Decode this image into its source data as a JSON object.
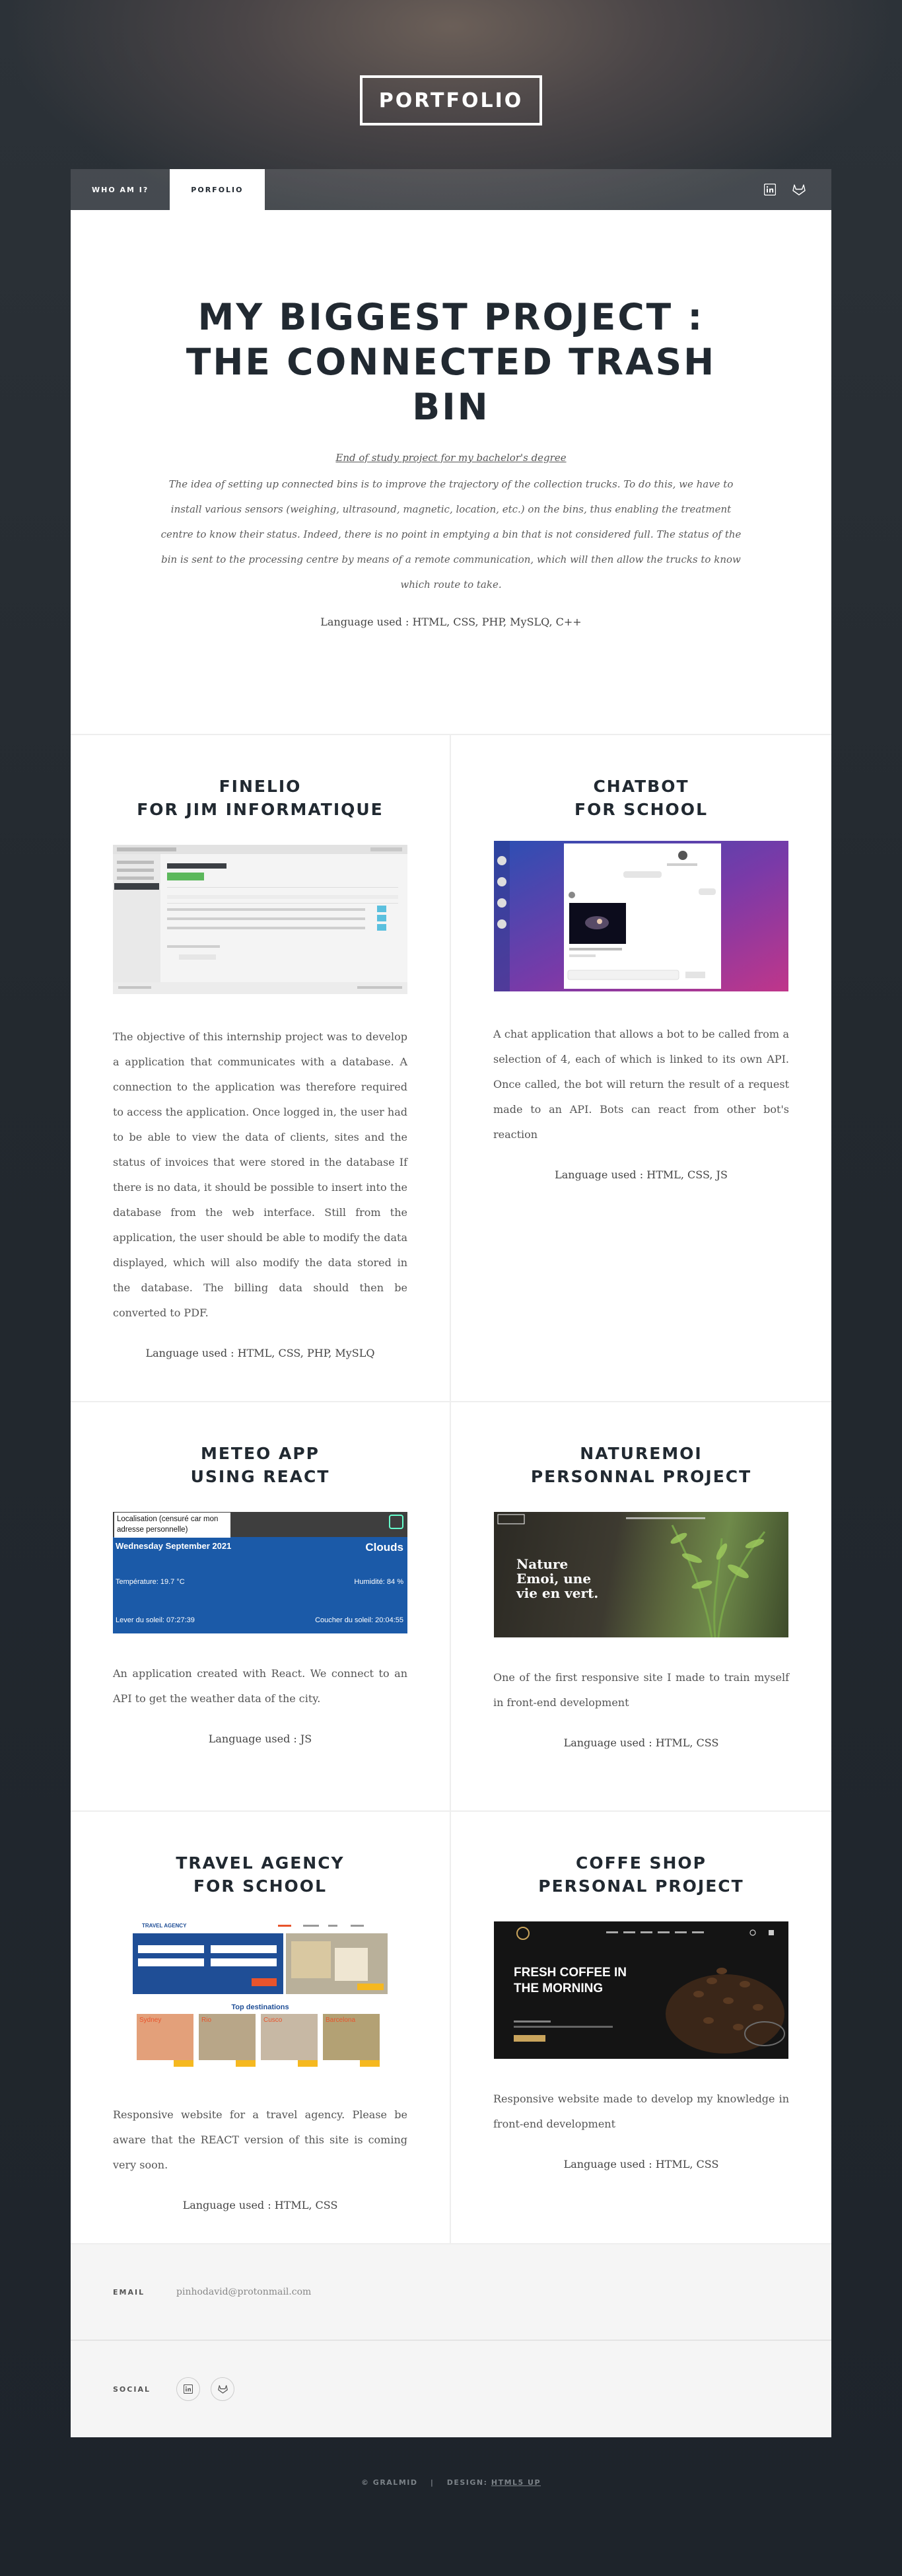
{
  "header": {
    "logo": "PORTFOLIO"
  },
  "nav": {
    "tabs": [
      {
        "label": "WHO AM I?"
      },
      {
        "label": "PORFOLIO"
      }
    ],
    "icons": [
      "linkedin-icon",
      "gitlab-icon"
    ]
  },
  "featured": {
    "title": "MY BIGGEST PROJECT : THE CONNECTED TRASH BIN",
    "subtitle": "End of study project for my bachelor's degree",
    "description": "The idea of setting up connected bins is to improve the trajectory of the collection trucks. To do this, we have to install various sensors (weighing, ultrasound, magnetic, location, etc.) on the bins, thus enabling the treatment centre to know their status. Indeed, there is no point in emptying a bin that is not considered full. The status of the bin is sent to the processing centre by means of a remote communication, which will then allow the trucks to know which route to take.",
    "language": "Language used : HTML, CSS, PHP, MySLQ, C++"
  },
  "projects": [
    {
      "title_line1": "FINELIO",
      "title_line2": "FOR JIM INFORMATIQUE",
      "description": "The objective of this internship project was to develop a application that communicates with a database. A connection to the application was therefore required to access the application. Once logged in, the user had to be able to view the data of clients, sites and the status of invoices that were stored in the database If there is no data, it should be possible to insert into the database from the web interface. Still from the application, the user should be able to modify the data displayed, which will also modify the data stored in the database. The billing data should then be converted to PDF.",
      "language": "Language used : HTML, CSS, PHP, MySLQ"
    },
    {
      "title_line1": "CHATBOT",
      "title_line2": "FOR SCHOOL",
      "description": "A chat application that allows a bot to be called from a selection of 4, each of which is linked to its own API. Once called, the bot will return the result of a request made to an API. Bots can react from other bot's reaction",
      "language": "Language used : HTML, CSS, JS"
    },
    {
      "title_line1": "METEO APP",
      "title_line2": "USING REACT",
      "description": "An application created with React. We connect to an API to get the weather data of the city.",
      "language": "Language used : JS",
      "weather": {
        "location_placeholder": "Localisation (censuré car mon adresse personnelle)",
        "date": "Wednesday September 2021",
        "condition": "Clouds",
        "temperature": "Température: 19.7 °C",
        "humidity": "Humidité: 84 %",
        "sunrise": "Lever du soleil: 07:27:39",
        "sunset": "Coucher du soleil: 20:04:55"
      }
    },
    {
      "title_line1": "NATUREMOI",
      "title_line2": "PERSONNAL PROJECT",
      "description": "One of the first responsive site I made to train myself in front-end development",
      "language": "Language used : HTML, CSS",
      "hero": {
        "line1": "Nature",
        "line2": "Emoi, une",
        "line3": "vie en vert."
      }
    },
    {
      "title_line1": "TRAVEL AGENCY",
      "title_line2": "FOR SCHOOL",
      "description": "Responsive website for a travel agency. Please be aware that the REACT version of this site is coming very soon.",
      "language": "Language used : HTML, CSS",
      "mock": {
        "brand": "TRAVEL AGENCY",
        "top_destinations": "Top destinations",
        "cities": [
          "Sydney",
          "Rio",
          "Cusco",
          "Barcelona"
        ]
      }
    },
    {
      "title_line1": "COFFE SHOP",
      "title_line2": "PERSONAL PROJECT",
      "description": "Responsive website made to develop my knowledge in front-end development",
      "language": "Language used : HTML, CSS",
      "hero": {
        "line1": "FRESH COFFEE IN",
        "line2": "THE MORNING"
      }
    }
  ],
  "footer": {
    "email_label": "EMAIL",
    "email": "pinhodavid@protonmail.com",
    "social_label": "SOCIAL"
  },
  "copyright": {
    "left": "© GRALMID",
    "right_prefix": "DESIGN:",
    "right_link": "HTML5 UP"
  },
  "colors": {
    "background": "#212931",
    "accent_blue": "#1f4e96",
    "accent_green": "#5cb85c"
  }
}
